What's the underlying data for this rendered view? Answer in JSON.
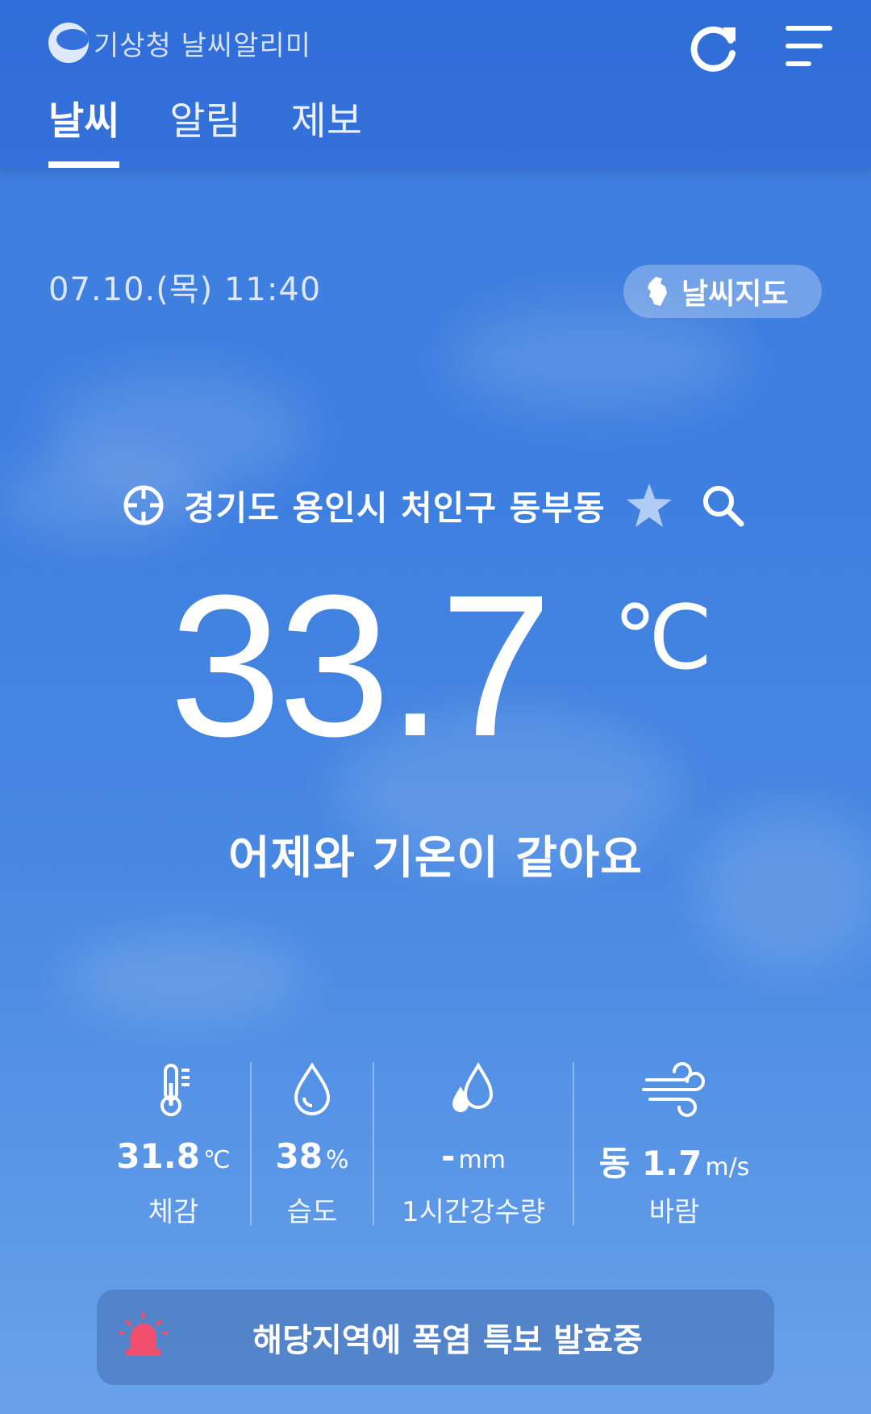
{
  "header": {
    "app_title": "기상청 날씨알리미",
    "tabs": [
      {
        "label": "날씨",
        "active": true
      },
      {
        "label": "알림",
        "active": false
      },
      {
        "label": "제보",
        "active": false
      }
    ]
  },
  "main": {
    "datetime": "07.10.(목) 11:40",
    "map_button_label": "날씨지도",
    "location": "경기도 용인시 처인구 동부동",
    "temperature": "33.7",
    "temperature_unit": "℃",
    "comparison": "어제와 기온이 같아요"
  },
  "stats": [
    {
      "value": "31.8",
      "unit": "℃",
      "label": "체감",
      "icon": "thermometer-icon"
    },
    {
      "value": "38",
      "unit": "%",
      "label": "습도",
      "icon": "humidity-drop-icon"
    },
    {
      "value": "-",
      "unit": "mm",
      "label": "1시간강수량",
      "icon": "rain-drops-icon"
    },
    {
      "value": "동 1.7",
      "unit": "m/s",
      "label": "바람",
      "icon": "wind-icon"
    }
  ],
  "alert": {
    "text": "해당지역에 폭염 특보 발효중",
    "icon": "siren-icon",
    "icon_color": "#f0506e"
  },
  "colors": {
    "background": "#3f7fde",
    "header": "#2f6dd8"
  }
}
